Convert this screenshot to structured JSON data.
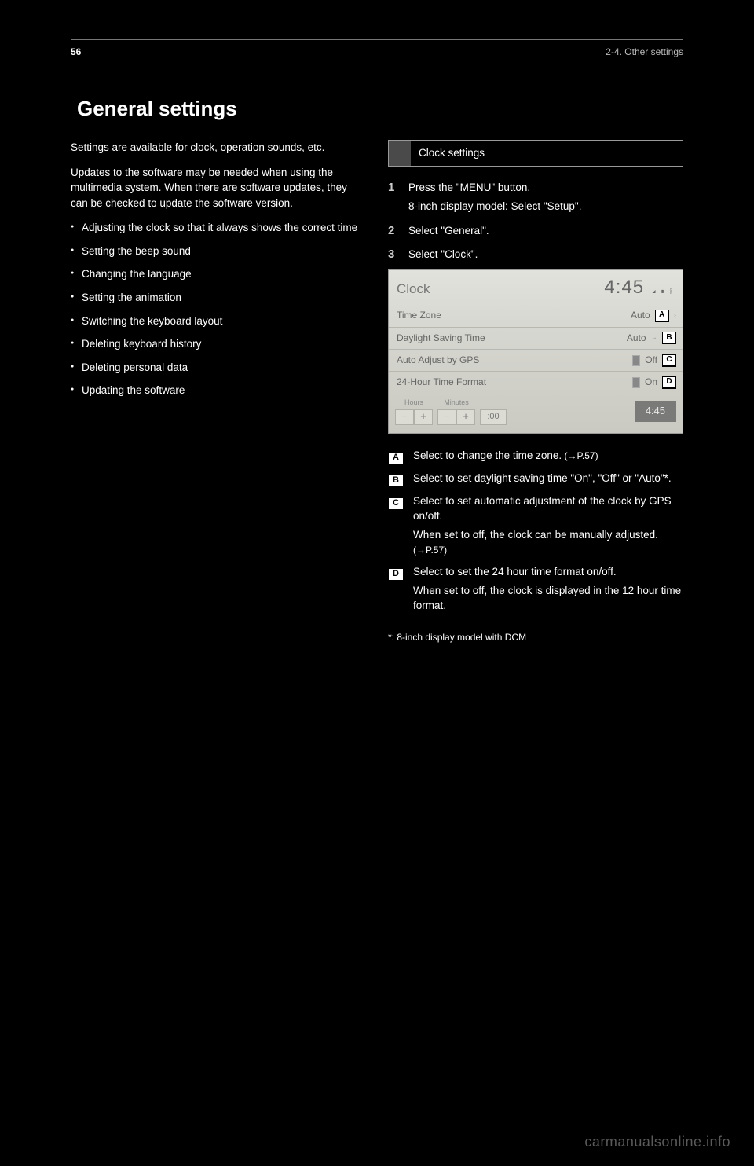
{
  "header": {
    "page_number": "56",
    "chapter": "2-4. Other settings"
  },
  "title": "General settings",
  "left_column": {
    "intro_1": "Settings are available for clock, operation sounds, etc.",
    "intro_2": "Updates to the software may be needed when using the multimedia system. When there are software updates, they can be checked to update the software version.",
    "list": [
      "Adjusting the clock so that it always shows the correct time",
      "Setting the beep sound",
      "Changing the language",
      "Setting the animation",
      "Switching the keyboard layout",
      "Deleting keyboard history",
      "Deleting personal data",
      "Updating the software"
    ]
  },
  "right_column": {
    "heading": "Clock settings",
    "step1_a": "Press the \"MENU\" button.",
    "step1_b": "8-inch display model: Select \"Setup\".",
    "step2": "Select \"General\".",
    "step3": "Select \"Clock\".",
    "descA": "Select to change the time zone.",
    "descA_ref": " (→P.57)",
    "descB": "Select to set daylight saving time \"On\", \"Off\" or \"Auto\"*.",
    "descC_1": "Select to set automatic adjustment of the clock by GPS on/off.",
    "descC_2": "When set to off, the clock can be manually adjusted.",
    "descC_ref": " (→P.57)",
    "descD_1": "Select to set the 24 hour time format on/off.",
    "descD_2": "When set to off, the clock is displayed in the 12 hour time format.",
    "footnote": "*: 8-inch display model with DCM"
  },
  "screenshot": {
    "title": "Clock",
    "clock": "4:45",
    "icons": "📶 🔋 ᛒ",
    "row_tz_label": "Time Zone",
    "row_tz_value": "Auto",
    "row_dst_label": "Daylight Saving Time",
    "row_dst_value": "Auto",
    "row_gps_label": "Auto Adjust by GPS",
    "row_gps_value": "Off",
    "row_24h_label": "24-Hour Time Format",
    "row_24h_value": "On",
    "hours_label": "Hours",
    "minutes_label": "Minutes",
    "zero_label": ":00",
    "preview_clock": "4:45"
  },
  "badges": {
    "a": "A",
    "b": "B",
    "c": "C",
    "d": "D"
  },
  "watermark": "carmanualsonline.info"
}
